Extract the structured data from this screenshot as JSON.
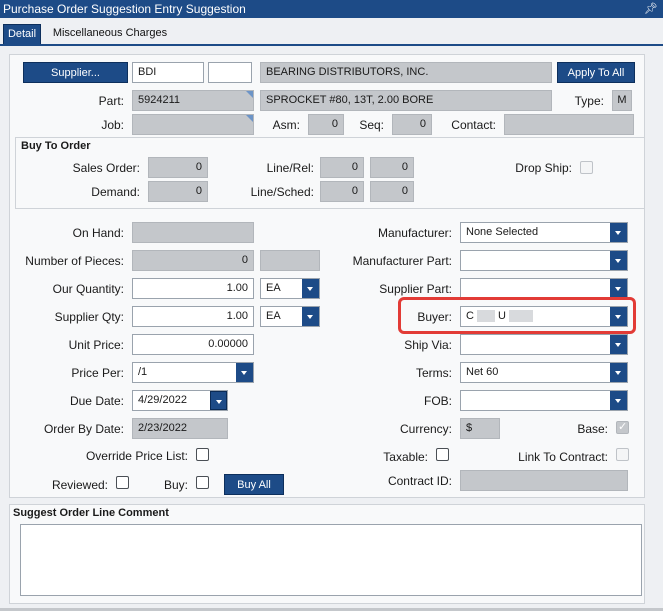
{
  "window": {
    "title": "Purchase Order Suggestion Entry Suggestion"
  },
  "tabs": [
    "Detail",
    "Miscellaneous Charges"
  ],
  "header": {
    "supplier_button": "Supplier...",
    "supplier_id": "BDI",
    "supplier_name": "BEARING DISTRIBUTORS, INC.",
    "apply_to_all": "Apply To All",
    "part_label": "Part:",
    "part_number": "5924211",
    "part_description": "SPROCKET #80, 13T, 2.00 BORE",
    "type_label": "Type:",
    "type_value": "M",
    "job_label": "Job:",
    "asm_label": "Asm:",
    "asm_value": "0",
    "seq_label": "Seq:",
    "seq_value": "0",
    "contact_label": "Contact:"
  },
  "buy_to_order": {
    "title": "Buy To Order",
    "sales_order_label": "Sales Order:",
    "sales_order_value": "0",
    "line_rel_label": "Line/Rel:",
    "line_value": "0",
    "rel_value": "0",
    "drop_ship_label": "Drop Ship:",
    "demand_label": "Demand:",
    "demand_value": "0",
    "line_sched_label": "Line/Sched:",
    "line_sched_line": "0",
    "line_sched_sched": "0"
  },
  "detail": {
    "on_hand_label": "On Hand:",
    "pieces_label": "Number of Pieces:",
    "pieces_value": "0",
    "our_qty_label": "Our Quantity:",
    "our_qty_value": "1.00",
    "our_uom": "EA",
    "supplier_qty_label": "Supplier Qty:",
    "supplier_qty_value": "1.00",
    "supplier_uom": "EA",
    "unit_price_label": "Unit Price:",
    "unit_price_value": "0.00000",
    "price_per_label": "Price Per:",
    "price_per_value": "/1",
    "due_date_label": "Due Date:",
    "due_date_value": "4/29/2022",
    "order_by_label": "Order By Date:",
    "order_by_value": "2/23/2022",
    "override_label": "Override Price List:",
    "reviewed_label": "Reviewed:",
    "buy_label": "Buy:",
    "buy_all_button": "Buy All",
    "manufacturer_label": "Manufacturer:",
    "manufacturer_value": "None Selected",
    "manufacturer_part_label": "Manufacturer Part:",
    "supplier_part_label": "Supplier Part:",
    "buyer_label": "Buyer:",
    "buyer_value_a": "C",
    "buyer_value_b": "U",
    "ship_via_label": "Ship Via:",
    "terms_label": "Terms:",
    "terms_value": "Net 60",
    "fob_label": "FOB:",
    "currency_label": "Currency:",
    "currency_value": "$",
    "base_label": "Base:",
    "taxable_label": "Taxable:",
    "link_contract_label": "Link To Contract:",
    "contract_id_label": "Contract ID:"
  },
  "comment": {
    "title": "Suggest Order Line Comment"
  },
  "colors": {
    "accent": "#1d4b87",
    "highlight": "#e23b36",
    "readonly": "#c4c7cb"
  }
}
